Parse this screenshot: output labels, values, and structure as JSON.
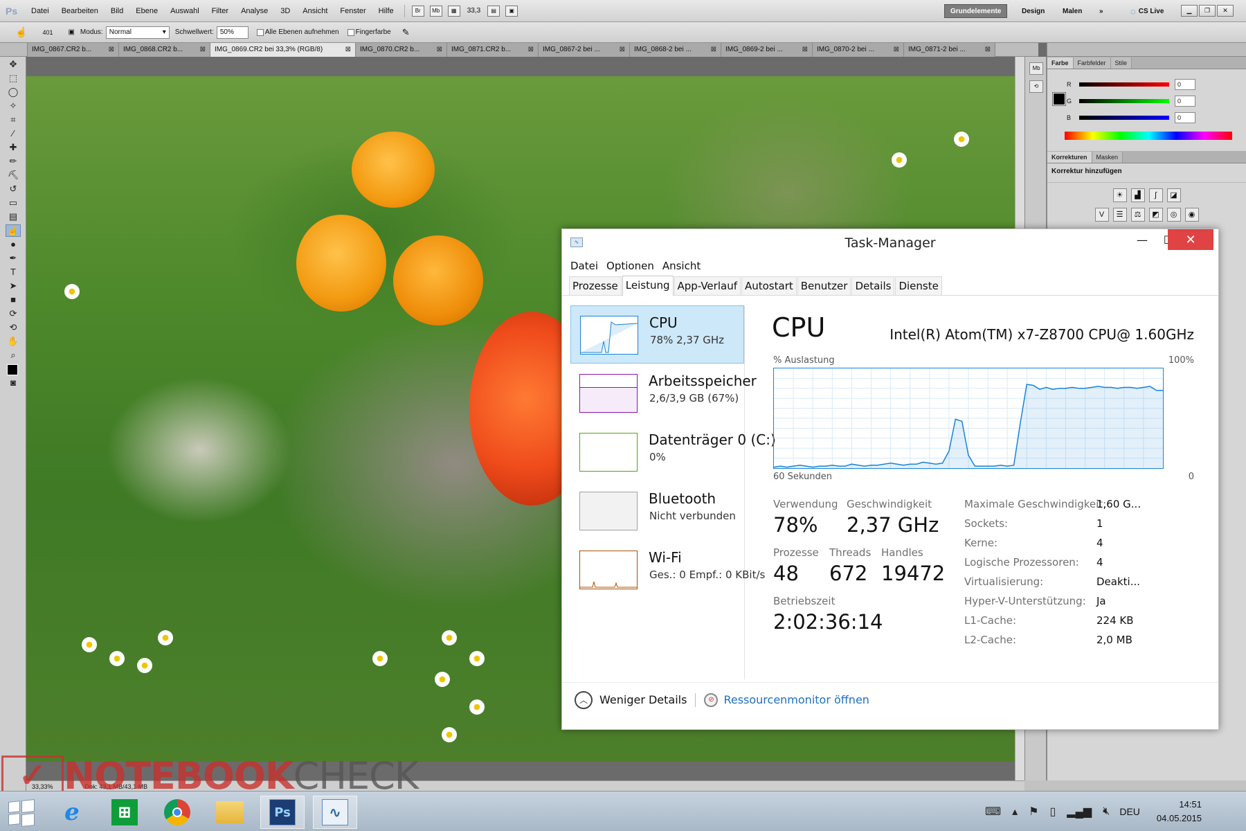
{
  "photoshop": {
    "logo": "Ps",
    "menus": [
      "Datei",
      "Bearbeiten",
      "Bild",
      "Ebene",
      "Auswahl",
      "Filter",
      "Analyse",
      "3D",
      "Ansicht",
      "Fenster",
      "Hilfe"
    ],
    "mini_buttons": [
      "Br",
      "Mb"
    ],
    "zoom_value": "33,3",
    "workspaces": [
      "Grundelemente",
      "Design",
      "Malen",
      "»"
    ],
    "cs_live": "CS Live",
    "options": {
      "brush_size": "401",
      "modus_label": "Modus:",
      "modus_value": "Normal",
      "schwellwert_label": "Schwellwert:",
      "schwellwert_value": "50%",
      "alle_ebenen": "Alle Ebenen aufnehmen",
      "fingerfarbe": "Fingerfarbe"
    },
    "doc_tabs": [
      {
        "label": "IMG_0867.CR2 b...",
        "active": false
      },
      {
        "label": "IMG_0868.CR2 b...",
        "active": false
      },
      {
        "label": "IMG_0869.CR2 bei 33,3% (RGB/8)",
        "active": true
      },
      {
        "label": "IMG_0870.CR2 b...",
        "active": false
      },
      {
        "label": "IMG_0871.CR2 b...",
        "active": false
      },
      {
        "label": "IMG_0867-2 bei ...",
        "active": false
      },
      {
        "label": "IMG_0868-2 bei ...",
        "active": false
      },
      {
        "label": "IMG_0869-2 bei ...",
        "active": false
      },
      {
        "label": "IMG_0870-2 bei ...",
        "active": false
      },
      {
        "label": "IMG_0871-2 bei ...",
        "active": false
      }
    ],
    "status": {
      "zoom": "33,33%",
      "doc": "Dok: 43,1 MB/43,1 MB"
    },
    "panels": {
      "color_tabs": [
        "Farbe",
        "Farbfelder",
        "Stile"
      ],
      "channels": [
        {
          "label": "R",
          "value": "0",
          "color": "#d01010"
        },
        {
          "label": "G",
          "value": "0",
          "color": "#10b010"
        },
        {
          "label": "B",
          "value": "0",
          "color": "#1010d0"
        }
      ],
      "adjust_tabs": [
        "Korrekturen",
        "Masken"
      ],
      "adjust_title": "Korrektur hinzufügen"
    }
  },
  "taskmanager": {
    "title": "Task-Manager",
    "menus": [
      "Datei",
      "Optionen",
      "Ansicht"
    ],
    "tabs": [
      "Prozesse",
      "Leistung",
      "App-Verlauf",
      "Autostart",
      "Benutzer",
      "Details",
      "Dienste"
    ],
    "active_tab": "Leistung",
    "sidebar": [
      {
        "name": "CPU",
        "sub": "78%  2,37 GHz",
        "color": "#1883d7"
      },
      {
        "name": "Arbeitsspeicher",
        "sub": "2,6/3,9 GB (67%)",
        "color": "#8b12ae"
      },
      {
        "name": "Datenträger 0 (C:)",
        "sub": "0%",
        "color": "#4da60c"
      },
      {
        "name": "Bluetooth",
        "sub": "Nicht verbunden",
        "color": "#a0a0a0"
      },
      {
        "name": "Wi-Fi",
        "sub": "Ges.:  0  Empf.:  0 KBit/s",
        "color": "#a74f01"
      }
    ],
    "detail": {
      "heading": "CPU",
      "model": "Intel(R) Atom(TM) x7-Z8700 CPU@ 1.60GHz",
      "graph_label_left": "% Auslastung",
      "graph_label_right": "100%",
      "graph_footer_left": "60 Sekunden",
      "graph_footer_right": "0",
      "stats": {
        "verwendung_label": "Verwendung",
        "verwendung": "78%",
        "geschw_label": "Geschwindigkeit",
        "geschw": "2,37 GHz",
        "prozesse_label": "Prozesse",
        "prozesse": "48",
        "threads_label": "Threads",
        "threads": "672",
        "handles_label": "Handles",
        "handles": "19472",
        "betrieb_label": "Betriebszeit",
        "betrieb": "2:02:36:14"
      },
      "specs": [
        {
          "k": "Maximale Geschwindigkeit:",
          "v": "1,60 G..."
        },
        {
          "k": "Sockets:",
          "v": "1"
        },
        {
          "k": "Kerne:",
          "v": "4"
        },
        {
          "k": "Logische Prozessoren:",
          "v": "4"
        },
        {
          "k": "Virtualisierung:",
          "v": "Deakti..."
        },
        {
          "k": "Hyper-V-Unterstützung:",
          "v": "Ja"
        },
        {
          "k": "L1-Cache:",
          "v": "224 KB"
        },
        {
          "k": "L2-Cache:",
          "v": "2,0 MB"
        }
      ]
    },
    "footer": {
      "fewer": "Weniger Details",
      "resmon": "Ressourcenmonitor öffnen"
    }
  },
  "chart_data": {
    "type": "area",
    "x": [
      0,
      1,
      2,
      3,
      4,
      5,
      6,
      7,
      8,
      9,
      10,
      11,
      12,
      13,
      14,
      15,
      16,
      17,
      18,
      19,
      20,
      21,
      22,
      23,
      24,
      25,
      26,
      27,
      28,
      29,
      30,
      31,
      32,
      33,
      34,
      35,
      36,
      37,
      38,
      39,
      40,
      41,
      42,
      43,
      44,
      45,
      46,
      47,
      48,
      49,
      50,
      51,
      52,
      53,
      54,
      55,
      56,
      57,
      58,
      59,
      60
    ],
    "values": [
      1,
      2,
      1,
      2,
      3,
      2,
      1,
      2,
      2,
      3,
      2,
      2,
      4,
      3,
      2,
      3,
      3,
      4,
      5,
      4,
      3,
      4,
      4,
      6,
      5,
      4,
      5,
      17,
      49,
      47,
      13,
      2,
      2,
      2,
      2,
      3,
      2,
      3,
      45,
      84,
      83,
      79,
      81,
      79,
      80,
      80,
      81,
      80,
      80,
      81,
      82,
      81,
      81,
      80,
      81,
      81,
      80,
      81,
      82,
      78,
      78
    ],
    "ylim": [
      0,
      100
    ],
    "color": "#1883d7"
  },
  "watermark": {
    "part1": "NOTEBOOK",
    "part2": "CHECK"
  },
  "taskbar": {
    "apps": [
      {
        "name": "internet-explorer",
        "glyph": "e",
        "color": "#1e88e5"
      },
      {
        "name": "store",
        "glyph": "⊞",
        "color": "#0f9d3a"
      },
      {
        "name": "chrome",
        "glyph": "●",
        "color": "#db4437"
      },
      {
        "name": "explorer",
        "glyph": "▭",
        "color": "#e5b53b"
      },
      {
        "name": "photoshop",
        "glyph": "Ps",
        "color": "#1c3d74"
      },
      {
        "name": "task-manager",
        "glyph": "∿",
        "color": "#5a86b8"
      }
    ],
    "lang": "DEU",
    "time": "14:51",
    "date": "04.05.2015"
  }
}
